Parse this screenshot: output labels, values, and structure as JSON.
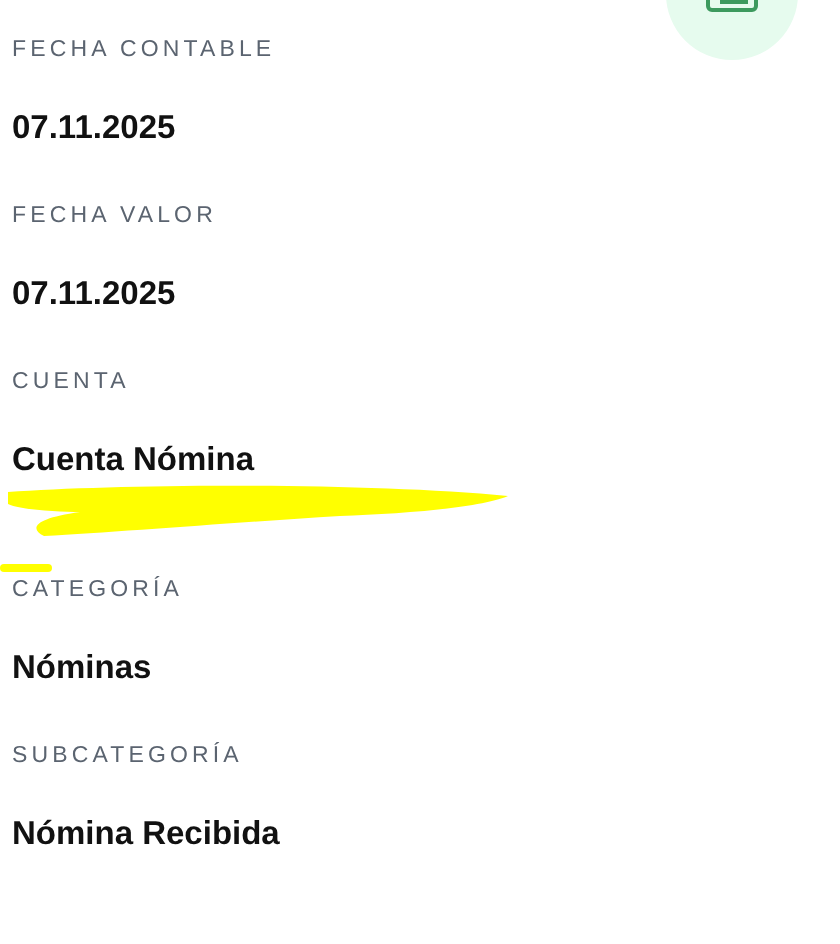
{
  "fields": [
    {
      "label": "FECHA CONTABLE",
      "value": "07.11.2025",
      "redacted": false
    },
    {
      "label": "FECHA VALOR",
      "value": "07.11.2025",
      "redacted": false
    },
    {
      "label": "CUENTA",
      "value": "Cuenta Nómina",
      "redacted": true
    },
    {
      "label": "CATEGORÍA",
      "value": "Nóminas",
      "redacted": false
    },
    {
      "label": "SUBCATEGORÍA",
      "value": "Nómina Recibida",
      "redacted": false
    }
  ]
}
